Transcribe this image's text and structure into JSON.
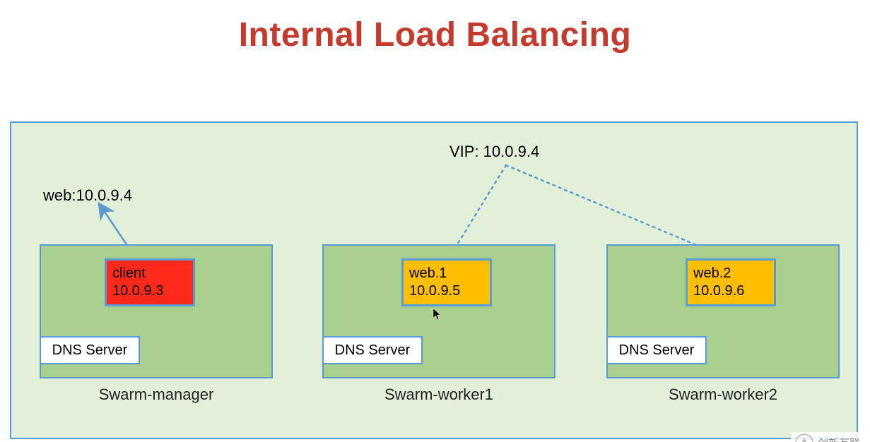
{
  "title": "Internal Load Balancing",
  "labels": {
    "web": "web:10.0.9.4",
    "vip": "VIP: 10.0.9.4"
  },
  "nodes": [
    {
      "caption": "Swarm-manager",
      "dns": "DNS Server",
      "service": {
        "name": "client",
        "ip": "10.0.9.3",
        "kind": "client"
      }
    },
    {
      "caption": "Swarm-worker1",
      "dns": "DNS Server",
      "service": {
        "name": "web.1",
        "ip": "10.0.9.5",
        "kind": "web"
      }
    },
    {
      "caption": "Swarm-worker2",
      "dns": "DNS Server",
      "service": {
        "name": "web.2",
        "ip": "10.0.9.6",
        "kind": "web"
      }
    }
  ],
  "watermark": "创新互联"
}
